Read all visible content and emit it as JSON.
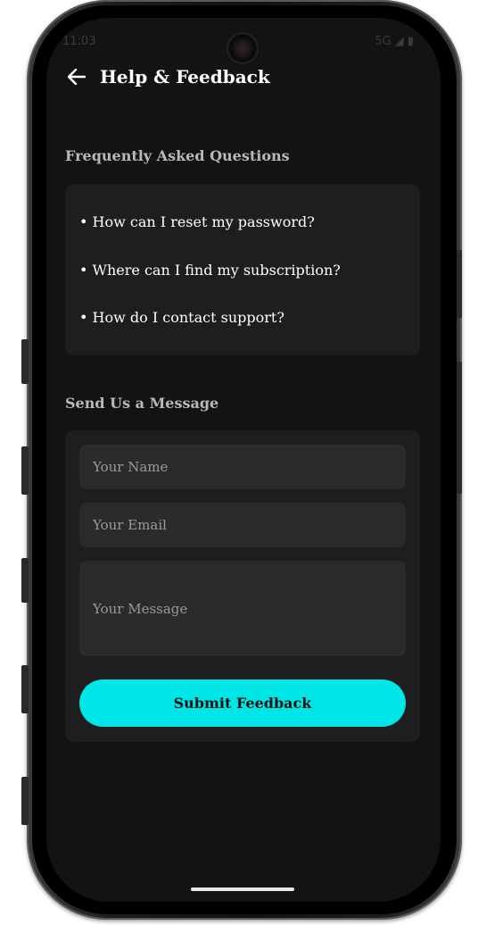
{
  "status_bar": {
    "time": "11:03",
    "network": "5G"
  },
  "header": {
    "title": "Help & Feedback",
    "back_icon": "arrow-left-icon"
  },
  "faq": {
    "section_title": "Frequently Asked Questions",
    "items": [
      "• How can I reset my password?",
      "• Where can I find my subscription?",
      "• How do I contact support?"
    ]
  },
  "message_form": {
    "section_title": "Send Us a Message",
    "name_placeholder": "Your Name",
    "email_placeholder": "Your Email",
    "message_placeholder": "Your Message",
    "submit_label": "Submit Feedback"
  },
  "colors": {
    "background": "#131313",
    "card": "#1e1e1e",
    "field": "#2b2b2b",
    "accent": "#00e5e5"
  }
}
